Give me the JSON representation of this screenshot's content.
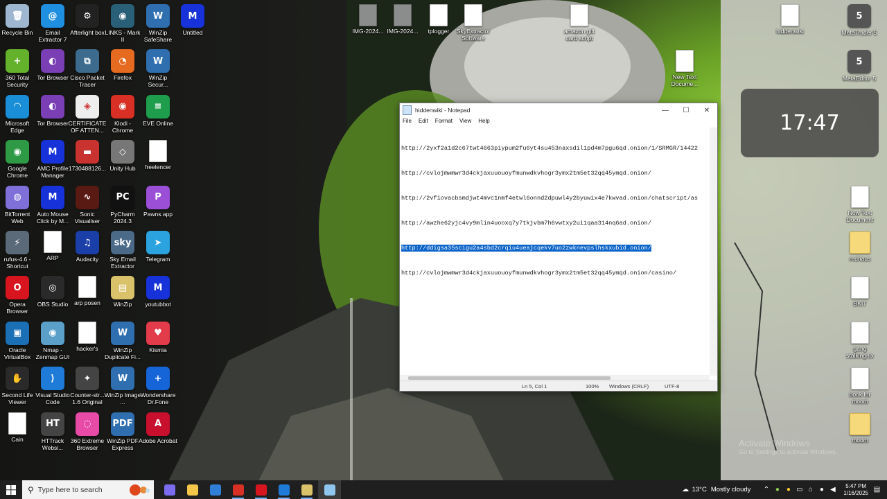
{
  "desktop": {
    "icons_left": [
      {
        "label": "Recycle Bin",
        "icon": "recycle-bin",
        "color": "#9fb6d0"
      },
      {
        "label": "Email Extractor 7",
        "icon": "at-sign",
        "color": "#1f8fe0"
      },
      {
        "label": "Afterlight box",
        "icon": "gear",
        "color": "#222222"
      },
      {
        "label": "LINKS - Mark II",
        "icon": "orb",
        "color": "#2a5f78"
      },
      {
        "label": "WinZip SafeShare",
        "icon": "winzip",
        "color": "#2f6fb0"
      },
      {
        "label": "Untitled",
        "icon": "m-logo",
        "color": "#1632d8"
      },
      {
        "label": "360 Total Security",
        "icon": "plus-shield",
        "color": "#64b12c"
      },
      {
        "label": "Tor Browser",
        "icon": "onion",
        "color": "#7a3fb5"
      },
      {
        "label": "Cisco Packet Tracer",
        "icon": "network",
        "color": "#3d6b8e"
      },
      {
        "label": "Firefox",
        "icon": "firefox",
        "color": "#e66a1f"
      },
      {
        "label": "WinZip Secur...",
        "icon": "winzip",
        "color": "#2f6fb0"
      },
      {
        "label": "Microsoft Edge",
        "icon": "edge",
        "color": "#1a8fd8"
      },
      {
        "label": "Tor Browser",
        "icon": "onion",
        "color": "#7a3fb5"
      },
      {
        "label": "CERTIFICATE OF ATTEN...",
        "icon": "chrome-doc",
        "color": "#eeeeee"
      },
      {
        "label": "Klodi - Chrome",
        "icon": "chrome",
        "color": "#d93025"
      },
      {
        "label": "EVE Online",
        "icon": "sheet",
        "color": "#1e9e4c"
      },
      {
        "label": "Google Chrome",
        "icon": "chrome",
        "color": "#2e9a45"
      },
      {
        "label": "AMC Profile Manager",
        "icon": "m-logo",
        "color": "#1632d8"
      },
      {
        "label": "1730488126...",
        "icon": "card",
        "color": "#c8322f"
      },
      {
        "label": "Unity Hub",
        "icon": "cube",
        "color": "#777777"
      },
      {
        "label": "freelencer",
        "icon": "file",
        "color": "#ffffff"
      },
      {
        "label": "BitTorrent Web",
        "icon": "torrent",
        "color": "#7f6fd8"
      },
      {
        "label": "Auto Mouse Click by M...",
        "icon": "m-logo",
        "color": "#1632d8"
      },
      {
        "label": "Sonic Visualiser",
        "icon": "waveform",
        "color": "#5a1a14"
      },
      {
        "label": "PyCharm 2024.3",
        "icon": "pycharm",
        "color": "#111111"
      },
      {
        "label": "Pawns.app",
        "icon": "pawn",
        "color": "#9b4fd6"
      },
      {
        "label": "rufus-4.6 - Shortcut",
        "icon": "usb",
        "color": "#5a6a78"
      },
      {
        "label": "ARP",
        "icon": "file",
        "color": "#ffffff"
      },
      {
        "label": "Audacity",
        "icon": "headphones",
        "color": "#1b3fa8"
      },
      {
        "label": "Sky Email Extractor",
        "icon": "sky",
        "color": "#4a6a88"
      },
      {
        "label": "Telegram",
        "icon": "telegram",
        "color": "#2aa3de"
      },
      {
        "label": "Opera Browser",
        "icon": "opera",
        "color": "#d8151e"
      },
      {
        "label": "OBS Studio",
        "icon": "obs",
        "color": "#2a2a2a"
      },
      {
        "label": "arp posen",
        "icon": "file",
        "color": "#ffffff"
      },
      {
        "label": "WinZip",
        "icon": "winzip-file",
        "color": "#d9c26a"
      },
      {
        "label": "youtubbot",
        "icon": "m-logo",
        "color": "#1632d8"
      },
      {
        "label": "Oracle VirtualBox",
        "icon": "virtualbox",
        "color": "#1b6fb5"
      },
      {
        "label": "Nmap - Zenmap GUI",
        "icon": "eye",
        "color": "#5aa0c8"
      },
      {
        "label": "hacker's",
        "icon": "file",
        "color": "#ffffff"
      },
      {
        "label": "WinZip Duplicate Fi...",
        "icon": "winzip",
        "color": "#2f6fb0"
      },
      {
        "label": "Kismia",
        "icon": "heart",
        "color": "#e23b4a"
      },
      {
        "label": "Second Life Viewer",
        "icon": "hand",
        "color": "#2a2a2a"
      },
      {
        "label": "Visual Studio Code",
        "icon": "vscode",
        "color": "#1f7bd8"
      },
      {
        "label": "Counter-str... 1.6 Original",
        "icon": "cs",
        "color": "#444444"
      },
      {
        "label": "WinZip Image ...",
        "icon": "winzip",
        "color": "#2f6fb0"
      },
      {
        "label": "Wondershare Dr.Fone",
        "icon": "plus",
        "color": "#1565d8"
      },
      {
        "label": "Cain",
        "icon": "file",
        "color": "#ffffff"
      },
      {
        "label": "HTTrack Websi...",
        "icon": "httrack",
        "color": "#444444"
      },
      {
        "label": "360 Extreme Browser",
        "icon": "rainbow",
        "color": "#e84aa8"
      },
      {
        "label": "WinZip PDF Express",
        "icon": "pdf",
        "color": "#2f6fb0"
      },
      {
        "label": "Adobe Acrobat",
        "icon": "acrobat",
        "color": "#c8102e"
      }
    ],
    "icons_top": [
      {
        "label": "IMG-2024...",
        "icon": "gray-file"
      },
      {
        "label": "IMG-2024...",
        "icon": "gray-file"
      },
      {
        "label": "tplogger",
        "icon": "file"
      },
      {
        "label": "SkyExtractor Software",
        "icon": "file"
      },
      {
        "label": "amazon gift card script",
        "icon": "file"
      },
      {
        "label": "hiddenwiki",
        "icon": "file"
      },
      {
        "label": "MetaTrader 5",
        "icon": "metatrader"
      },
      {
        "label": "New Text Docume...",
        "icon": "file"
      },
      {
        "label": "MetaEditor 5",
        "icon": "metaeditor"
      }
    ],
    "icons_right": [
      {
        "label": "New Text Document",
        "icon": "file"
      },
      {
        "label": "redhaus",
        "icon": "folder"
      },
      {
        "label": "BKIT",
        "icon": "file"
      },
      {
        "label": "gang stalkingnix",
        "icon": "file"
      },
      {
        "label": "book for moom",
        "icon": "file"
      },
      {
        "label": "moom",
        "icon": "folder"
      }
    ]
  },
  "clock_widget": {
    "time": "17:47"
  },
  "notepad": {
    "title": "hiddenwiki - Notepad",
    "menu": [
      "File",
      "Edit",
      "Format",
      "View",
      "Help"
    ],
    "lines": [
      "http://2yxf2a1d2c67twt4663piypum2fu6yt4su453naxsdil1pd4m7pgu6qd.onion/1/SRMGR/14422",
      "http://cvlojmwmwr3d4ckjaxuuouoyfmunwdkvhogr3ymx2tm5et32qq45ymqd.onion/",
      "http://2vfiovacbsmdjwt4mvc1nmf4etwl6onnd2dpuwl4y2byuwix4e7kwvad.onion/chatscript/as",
      "http://awzhe62yjc4vy9mlin4uooxq7y7tkjvbm7h6vwtxy2ui1qaa314nq6ad.onion/",
      "http://ddigsa35scigu2a4sbd2crqiu4ueajcqekv7uo2zwknevpslhskxubid.onion/",
      "http://cvlojmwmwr3d4ckjaxuuouoyfmunwdkvhogr3ymx2tm5et32qq45ymqd.onion/casino/"
    ],
    "selected_line": 4,
    "status": {
      "position": "Ln 5, Col 1",
      "zoom": "100%",
      "line_ending": "Windows (CRLF)",
      "encoding": "UTF-8"
    }
  },
  "watermark": {
    "line1": "Activate Windows",
    "line2": "Go to Settings to activate Windows."
  },
  "taskbar": {
    "search_placeholder": "Type here to search",
    "apps": [
      {
        "name": "copilot",
        "color": "#7b6cf0",
        "state": ""
      },
      {
        "name": "file-explorer",
        "color": "#f3c64a",
        "state": ""
      },
      {
        "name": "microsoft-store",
        "color": "#2f7fd8",
        "state": ""
      },
      {
        "name": "chrome",
        "color": "#d93025",
        "state": "active"
      },
      {
        "name": "opera",
        "color": "#d8151e",
        "state": "active"
      },
      {
        "name": "vscode",
        "color": "#1f7bd8",
        "state": "active"
      },
      {
        "name": "winzip",
        "color": "#d9c26a",
        "state": "active"
      },
      {
        "name": "notepad",
        "color": "#8fc6ef",
        "state": "open"
      }
    ],
    "weather": {
      "temp": "13°C",
      "condition": "Mostly cloudy"
    },
    "time": "5:47 PM",
    "date": "1/16/2025"
  }
}
